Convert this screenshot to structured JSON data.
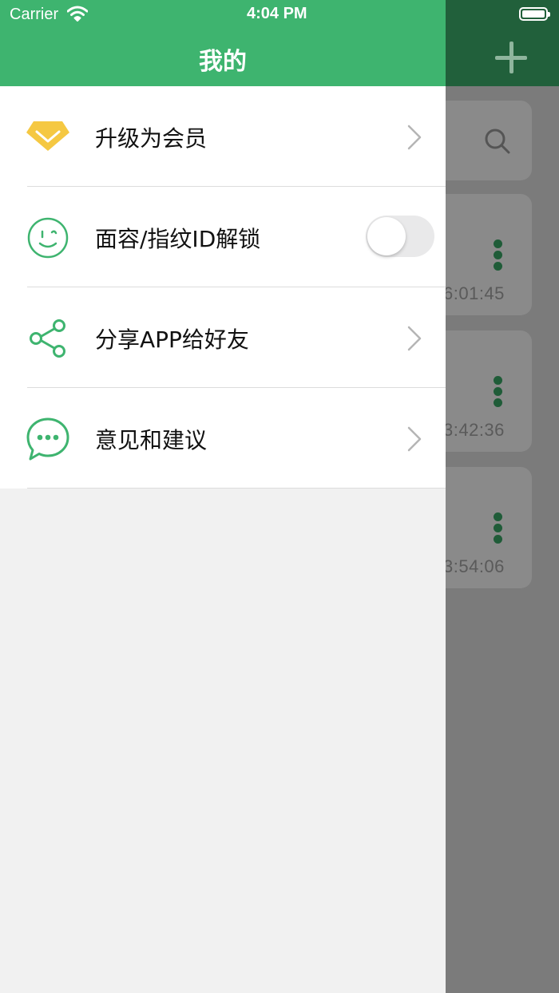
{
  "status_bar": {
    "carrier": "Carrier",
    "time": "4:04 PM"
  },
  "drawer": {
    "title": "我的",
    "items": [
      {
        "label": "升级为会员",
        "icon": "diamond-icon",
        "accessory": "chevron"
      },
      {
        "label": "面容/指纹ID解锁",
        "icon": "smiley-face-icon",
        "accessory": "toggle",
        "toggle_on": false
      },
      {
        "label": "分享APP给好友",
        "icon": "share-icon",
        "accessory": "chevron"
      },
      {
        "label": "意见和建议",
        "icon": "chat-bubble-icon",
        "accessory": "chevron"
      }
    ]
  },
  "background_screen": {
    "times": [
      "6:01:45",
      "3:42:36",
      "3:54:06"
    ]
  },
  "colors": {
    "accent": "#3eb46f",
    "diamond": "#f5c842",
    "background": "#f1f1f1"
  }
}
